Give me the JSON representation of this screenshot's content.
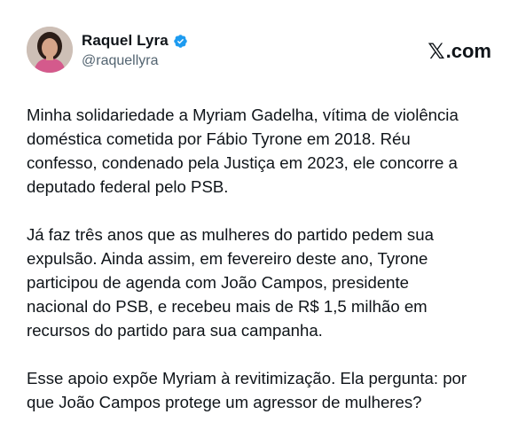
{
  "author": {
    "display_name": "Raquel Lyra",
    "handle": "@raquellyra",
    "verified": true
  },
  "brand": {
    "label": ".com",
    "icon": "x-logo-icon"
  },
  "colors": {
    "text": "#0f1419",
    "secondary": "#536471",
    "verified": "#1d9bf0"
  },
  "post": {
    "paragraphs": [
      "Minha solidariedade a Myriam Gadelha, vítima de violência\ndoméstica cometida por Fábio Tyrone em 2018. Réu\nconfesso, condenado pela Justiça em 2023, ele concorre a\ndeputado federal pelo PSB.",
      "Já faz três anos que as mulheres do partido pedem sua\nexpulsão. Ainda assim, em fevereiro deste ano, Tyrone\nparticipou de agenda com João Campos, presidente\nnacional do PSB, e recebeu mais de R$ 1,5 milhão em\nrecursos do partido para sua campanha.",
      "Esse apoio expõe Myriam à revitimização. Ela pergunta: por\nque João Campos protege um agressor de mulheres?"
    ]
  }
}
